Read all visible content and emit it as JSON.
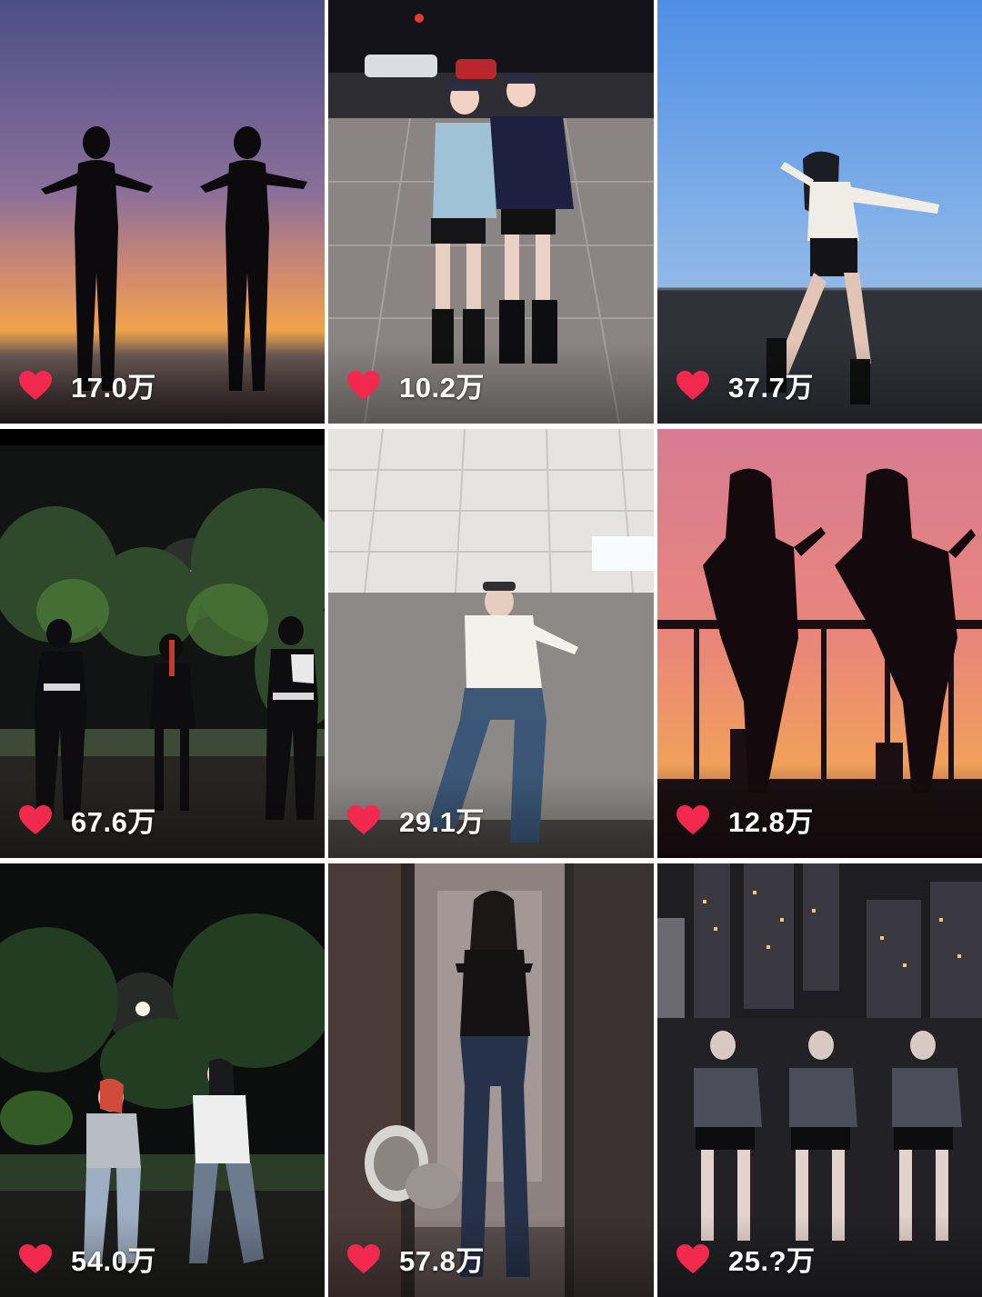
{
  "feed": {
    "videos": [
      {
        "likes": "17.0万",
        "scene": "sunset-silhouette-duo"
      },
      {
        "likes": "10.2万",
        "scene": "night-street-duo"
      },
      {
        "likes": "37.7万",
        "scene": "rooftop-blue-sky-solo"
      },
      {
        "likes": "67.6万",
        "scene": "night-park-trio"
      },
      {
        "likes": "29.1万",
        "scene": "office-corridor-solo"
      },
      {
        "likes": "12.8万",
        "scene": "pink-sunset-balcony-duo"
      },
      {
        "likes": "54.0万",
        "scene": "night-park-duo"
      },
      {
        "likes": "57.8万",
        "scene": "hallway-solo"
      },
      {
        "likes": "25.?万",
        "scene": "city-night-trio"
      }
    ]
  },
  "icons": {
    "like": "heart-icon"
  },
  "colors": {
    "heart": "#f2294f",
    "count_text": "#ffffff",
    "gap": "#ffffff"
  }
}
